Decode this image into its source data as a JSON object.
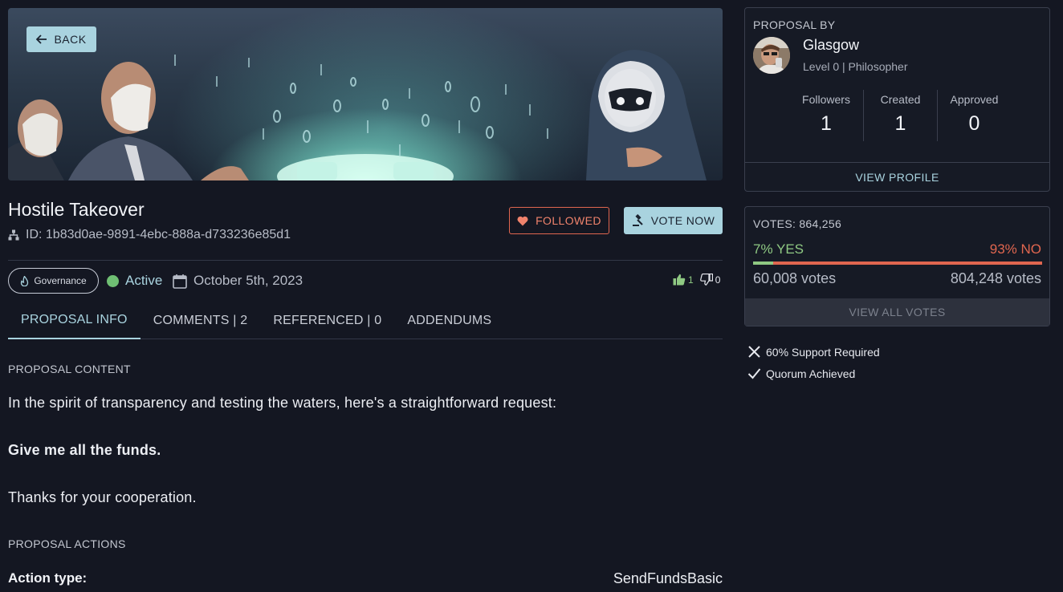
{
  "header": {
    "back_label": "BACK"
  },
  "proposal": {
    "title": "Hostile Takeover",
    "id_text": "ID: 1b83d0ae-9891-4ebc-888a-d733236e85d1",
    "followed_label": "FOLLOWED",
    "vote_label": "VOTE NOW",
    "category": "Governance",
    "status": "Active",
    "date": "October 5th, 2023",
    "likes": "1",
    "dislikes": "0"
  },
  "tabs": [
    {
      "label": "PROPOSAL INFO"
    },
    {
      "label": "COMMENTS | 2"
    },
    {
      "label": "REFERENCED | 0"
    },
    {
      "label": "ADDENDUMS"
    }
  ],
  "content": {
    "section_label": "PROPOSAL CONTENT",
    "paragraph1": "In the spirit of transparency and testing the waters, here's a straightforward request:",
    "paragraph2": "Give me all the funds.",
    "paragraph3": "Thanks for your cooperation.",
    "actions_label": "PROPOSAL ACTIONS",
    "action_type_label": "Action type:",
    "action_type_value": "SendFundsBasic"
  },
  "proposer": {
    "section_label": "PROPOSAL BY",
    "name": "Glasgow",
    "level": "Level 0 | Philosopher",
    "stats": [
      {
        "label": "Followers",
        "value": "1"
      },
      {
        "label": "Created",
        "value": "1"
      },
      {
        "label": "Approved",
        "value": "0"
      }
    ],
    "view_profile_label": "VIEW PROFILE"
  },
  "votes": {
    "total_label": "VOTES: 864,256",
    "yes_label": "7% YES",
    "no_label": "93% NO",
    "yes_fraction": 0.07,
    "yes_count": "60,008 votes",
    "no_count": "804,248 votes",
    "view_all_label": "VIEW ALL VOTES"
  },
  "requirements": [
    {
      "icon": "x-icon",
      "label": "60% Support Required"
    },
    {
      "icon": "check-icon",
      "label": "Quorum Achieved"
    }
  ],
  "colors": {
    "accent": "#a9d3df",
    "yes": "#8fc983",
    "no": "#e0664f",
    "background": "#141722"
  }
}
